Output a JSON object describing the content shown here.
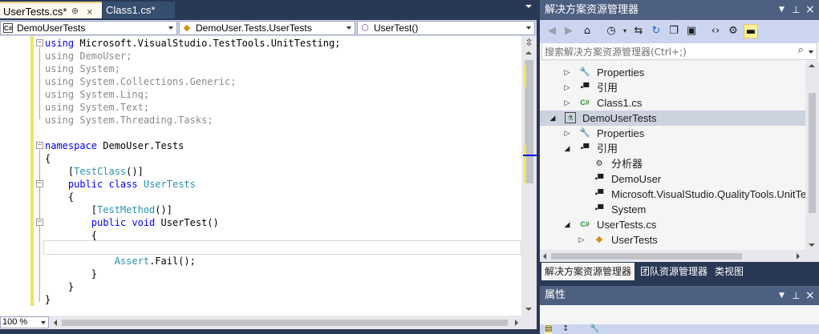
{
  "editor": {
    "tabs": [
      {
        "label": "UserTests.cs*",
        "active": true
      },
      {
        "label": "Class1.cs*",
        "active": false
      }
    ],
    "pin_glyph": "⊕",
    "close_glyph": "×",
    "nav": {
      "project": {
        "icon": "C#",
        "label": "DemoUserTests"
      },
      "class": {
        "icon": "class-icon",
        "label": "DemoUser.Tests.UserTests"
      },
      "member": {
        "icon": "method-icon",
        "label": "UserTest()"
      }
    },
    "code_lines": [
      {
        "parts": [
          {
            "t": "using",
            "c": "kw"
          },
          {
            "t": " Microsoft.VisualStudio.TestTools.UnitTesting;",
            "c": ""
          }
        ]
      },
      {
        "parts": [
          {
            "t": "using DemoUser;",
            "c": "dim"
          }
        ]
      },
      {
        "parts": [
          {
            "t": "using System;",
            "c": "dim"
          }
        ]
      },
      {
        "parts": [
          {
            "t": "using System.Collections.Generic;",
            "c": "dim"
          }
        ]
      },
      {
        "parts": [
          {
            "t": "using System.Linq;",
            "c": "dim"
          }
        ]
      },
      {
        "parts": [
          {
            "t": "using System.Text;",
            "c": "dim"
          }
        ]
      },
      {
        "parts": [
          {
            "t": "using System.Threading.Tasks;",
            "c": "dim"
          }
        ]
      },
      {
        "parts": []
      },
      {
        "parts": [
          {
            "t": "namespace",
            "c": "kw"
          },
          {
            "t": " DemoUser.Tests",
            "c": ""
          }
        ]
      },
      {
        "parts": [
          {
            "t": "{",
            "c": ""
          }
        ]
      },
      {
        "parts": [
          {
            "t": "    [",
            "c": ""
          },
          {
            "t": "TestClass",
            "c": "cls"
          },
          {
            "t": "()]",
            "c": ""
          }
        ]
      },
      {
        "parts": [
          {
            "t": "    ",
            "c": ""
          },
          {
            "t": "public class",
            "c": "kw"
          },
          {
            "t": " ",
            "c": ""
          },
          {
            "t": "UserTests",
            "c": "cls"
          }
        ]
      },
      {
        "parts": [
          {
            "t": "    {",
            "c": ""
          }
        ]
      },
      {
        "parts": [
          {
            "t": "        [",
            "c": ""
          },
          {
            "t": "TestMethod",
            "c": "cls"
          },
          {
            "t": "()]",
            "c": ""
          }
        ]
      },
      {
        "parts": [
          {
            "t": "        ",
            "c": ""
          },
          {
            "t": "public void",
            "c": "kw"
          },
          {
            "t": " UserTest()",
            "c": ""
          }
        ]
      },
      {
        "parts": [
          {
            "t": "        {",
            "c": ""
          }
        ]
      },
      {
        "parts": []
      },
      {
        "parts": [
          {
            "t": "            ",
            "c": ""
          },
          {
            "t": "Assert",
            "c": "cls"
          },
          {
            "t": ".Fail();",
            "c": ""
          }
        ]
      },
      {
        "parts": [
          {
            "t": "        }",
            "c": ""
          }
        ]
      },
      {
        "parts": [
          {
            "t": "    }",
            "c": ""
          }
        ]
      },
      {
        "parts": [
          {
            "t": "}",
            "c": ""
          }
        ]
      }
    ],
    "zoom": "100 %"
  },
  "solution_explorer": {
    "title": "解决方案资源管理器",
    "search_placeholder": "搜索解决方案资源管理器(Ctrl+;)",
    "tree": [
      {
        "label": "Properties",
        "icon": "wrench-icon",
        "expander": "right"
      },
      {
        "label": "引用",
        "icon": "reference-icon",
        "expander": "right"
      },
      {
        "label": "Class1.cs",
        "icon": "csharp-file-icon",
        "expander": "right"
      },
      {
        "label": "DemoUserTests",
        "icon": "test-project-icon",
        "expander": "down",
        "selected": true
      },
      {
        "label": "Properties",
        "icon": "wrench-icon",
        "expander": "right"
      },
      {
        "label": "引用",
        "icon": "reference-icon",
        "expander": "down"
      },
      {
        "label": "分析器",
        "icon": "analyzer-icon",
        "expander": ""
      },
      {
        "label": "DemoUser",
        "icon": "reference-icon",
        "expander": ""
      },
      {
        "label": "Microsoft.VisualStudio.QualityTools.UnitTe",
        "icon": "reference-icon",
        "expander": ""
      },
      {
        "label": "System",
        "icon": "reference-icon",
        "expander": ""
      },
      {
        "label": "UserTests.cs",
        "icon": "csharp-file-icon",
        "expander": "down"
      },
      {
        "label": "UserTests",
        "icon": "class-icon",
        "expander": "right"
      }
    ],
    "bottom_tabs": [
      {
        "label": "解决方案资源管理器",
        "active": true
      },
      {
        "label": "团队资源管理器",
        "active": false
      },
      {
        "label": "类视图",
        "active": false
      }
    ]
  },
  "properties": {
    "title": "属性"
  },
  "colors": {
    "frame": "#293955",
    "title_bar": "#4d6082",
    "keyword": "#0000ff",
    "type": "#2b91af",
    "change_marker": "#efe36a",
    "selection": "#cdd2df"
  }
}
